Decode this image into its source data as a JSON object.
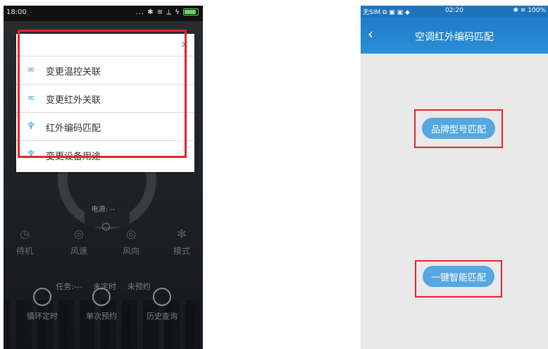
{
  "left": {
    "status_bar": {
      "time": "18:00",
      "icons": "... ✱ ≋ ⟂ ϟ"
    },
    "menu": {
      "items": [
        {
          "icon": "link-check-icon",
          "label": "变更温控关联"
        },
        {
          "icon": "link-x-icon",
          "label": "变更红外关联"
        },
        {
          "icon": "infrared-plug-icon",
          "label": "红外编码匹配"
        },
        {
          "icon": "plug-icon",
          "label": "变更设备用途"
        }
      ]
    },
    "power_label": "电源: --",
    "controls": [
      "待机",
      "风速",
      "风向",
      "模式"
    ],
    "task_row": [
      "任务:---",
      "未定时",
      "未预约"
    ],
    "bottom_buttons": [
      "循环定时",
      "单次预约",
      "历史查询"
    ]
  },
  "right": {
    "status_bar": {
      "left": "无SIM ⧉ ▣ ▣ ◆",
      "time": "02:20",
      "right": "✱ ≋ 100%"
    },
    "nav": {
      "title": "空调红外编码匹配"
    },
    "buttons": {
      "brand_match": "品牌型号匹配",
      "smart_match": "一键智能匹配"
    }
  },
  "colors": {
    "accent": "#3ba0d8",
    "highlight_box": "#e0262b",
    "nav_blue": "#1f7cc8"
  }
}
